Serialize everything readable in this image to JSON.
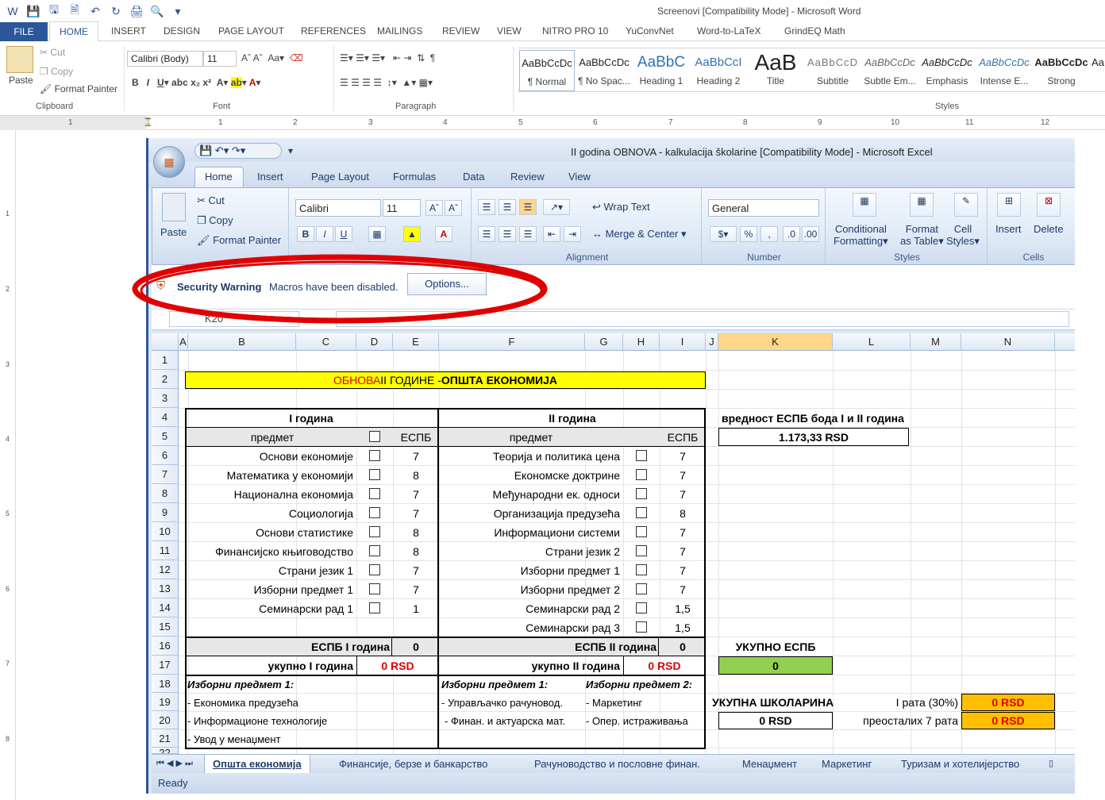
{
  "word": {
    "window_title": "Screenovi [Compatibility Mode] - Microsoft Word",
    "tabs": [
      "FILE",
      "HOME",
      "INSERT",
      "DESIGN",
      "PAGE LAYOUT",
      "REFERENCES",
      "MAILINGS",
      "REVIEW",
      "VIEW",
      "NITRO PRO 10",
      "YuConvNet",
      "Word-to-LaTeX",
      "GrindEQ Math"
    ],
    "clipboard": {
      "paste": "Paste",
      "cut": "Cut",
      "copy": "Copy",
      "format_painter": "Format Painter",
      "label": "Clipboard"
    },
    "font": {
      "name": "Calibri (Body)",
      "size": "11",
      "label": "Font"
    },
    "paragraph_label": "Paragraph",
    "styles_label": "Styles",
    "styles": [
      {
        "preview": "AaBbCcDc",
        "name": "¶ Normal"
      },
      {
        "preview": "AaBbCcDc",
        "name": "¶ No Spac..."
      },
      {
        "preview": "AaBbC",
        "name": "Heading 1"
      },
      {
        "preview": "AaBbCcI",
        "name": "Heading 2"
      },
      {
        "preview": "AaB",
        "name": "Title"
      },
      {
        "preview": "AaBbCcD",
        "name": "Subtitle"
      },
      {
        "preview": "AaBbCcDc",
        "name": "Subtle Em..."
      },
      {
        "preview": "AaBbCcDc",
        "name": "Emphasis"
      },
      {
        "preview": "AaBbCcDc",
        "name": "Intense E..."
      },
      {
        "preview": "AaBbCcDc",
        "name": "Strong"
      },
      {
        "preview": "Aa",
        "name": ""
      }
    ],
    "ruler_numbers": [
      "1",
      "1",
      "2",
      "3",
      "4",
      "5",
      "6",
      "7",
      "8",
      "9",
      "10",
      "11",
      "12"
    ],
    "vruler_numbers": [
      "1",
      "2",
      "3",
      "4",
      "5",
      "6",
      "7",
      "8"
    ]
  },
  "excel": {
    "window_title": "II godina OBNOVA - kalkulacija školarine  [Compatibility Mode] - Microsoft Excel",
    "tabs": [
      "Home",
      "Insert",
      "Page Layout",
      "Formulas",
      "Data",
      "Review",
      "View"
    ],
    "clipboard": {
      "paste": "Paste",
      "cut": "Cut",
      "copy": "Copy",
      "format_painter": "Format Painter",
      "label": "Clipboard"
    },
    "font": {
      "name": "Calibri",
      "size": "11",
      "label": "Font"
    },
    "alignment": {
      "wrap": "Wrap Text",
      "merge": "Merge & Center",
      "label": "Alignment"
    },
    "number": {
      "format": "General",
      "label": "Number"
    },
    "styles": {
      "cond": "Conditional",
      "cond2": "Formatting",
      "fmt": "Format",
      "fmt2": "as Table",
      "cell": "Cell",
      "cell2": "Styles",
      "label": "Styles"
    },
    "cells": {
      "insert": "Insert",
      "delete": "Delete",
      "label": "Cells"
    },
    "security": {
      "title": "Security Warning",
      "message": "Macros have been disabled.",
      "button": "Options..."
    },
    "name_box": "K20",
    "columns": [
      "A",
      "B",
      "C",
      "D",
      "E",
      "F",
      "G",
      "H",
      "I",
      "J",
      "K",
      "L",
      "M",
      "N"
    ],
    "rows": [
      "1",
      "2",
      "3",
      "4",
      "5",
      "6",
      "7",
      "8",
      "9",
      "10",
      "11",
      "12",
      "13",
      "14",
      "15",
      "16",
      "17",
      "18",
      "19",
      "20",
      "21",
      "22"
    ],
    "title_red": "ОБНОВА",
    "title_rest": " II ГОДИНЕ - ",
    "title_bold": "ОПШТА ЕКОНОМИЈА",
    "year1": "I година",
    "year2": "II година",
    "subject": "предмет",
    "espb": "ЕСПБ",
    "espb_value_label": "вредност ЕСПБ бода I и II година",
    "espb_value": "1.173,33 RSD",
    "y1_subjects": [
      {
        "name": "Основи економије",
        "espb": "7"
      },
      {
        "name": "Математика у економији",
        "espb": "8"
      },
      {
        "name": "Национална економија",
        "espb": "7"
      },
      {
        "name": "Социологија",
        "espb": "7"
      },
      {
        "name": "Основи статистике",
        "espb": "8"
      },
      {
        "name": "Финансијско књиговодство",
        "espb": "8"
      },
      {
        "name": "Страни језик 1",
        "espb": "7"
      },
      {
        "name": "Изборни предмет 1",
        "espb": "7"
      },
      {
        "name": "Семинарски рад 1",
        "espb": "1"
      }
    ],
    "y2_subjects": [
      {
        "name": "Теорија и политика цена",
        "espb": "7"
      },
      {
        "name": "Економске доктрине",
        "espb": "7"
      },
      {
        "name": "Међународни ек. односи",
        "espb": "7"
      },
      {
        "name": "Организација предузећа",
        "espb": "8"
      },
      {
        "name": "Информациони системи",
        "espb": "7"
      },
      {
        "name": "Страни језик 2",
        "espb": "7"
      },
      {
        "name": "Изборни предмет 1",
        "espb": "7"
      },
      {
        "name": "Изборни предмет 2",
        "espb": "7"
      },
      {
        "name": "Семинарски рад 2",
        "espb": "1,5"
      },
      {
        "name": "Семинарски рад 3",
        "espb": "1,5"
      }
    ],
    "espb_y1_label": "ЕСПБ I година",
    "espb_y1": "0",
    "espb_y2_label": "ЕСПБ II година",
    "espb_y2": "0",
    "total_y1_label": "укупно I година",
    "total_y1": "0 RSD",
    "total_y2_label": "укупно II година",
    "total_y2": "0 RSD",
    "total_espb_label": "УКУПНО ЕСПБ",
    "total_espb": "0",
    "elective1_head": "Изборни предмет 1:",
    "elective1_y1": [
      "- Економика предузећа",
      "- Информационе технологије",
      "- Увод у менаџмент"
    ],
    "elective1_y2_head": "Изборни предмет 1:",
    "elective1_y2": [
      "- Управљачко рачуновод.",
      "- Финан. и актуарска мат."
    ],
    "elective2_head": "Изборни предмет 2:",
    "elective2": [
      "- Маркетинг",
      "- Опер. истраживања"
    ],
    "tuition_label": "УКУПНА ШКОЛАРИНА",
    "tuition": "0 RSD",
    "rate1_label": "I рата (30%)",
    "rate1": "0 RSD",
    "rate_rest_label": "преосталих 7 рата",
    "rate_rest": "0 RSD",
    "sheets": [
      "Општа економија",
      "Финансије, берзе и банкарство",
      "Рачуноводство и пословне финан.",
      "Менаџмент",
      "Маркетинг",
      "Туризам и хотелијерство"
    ],
    "status": "Ready"
  },
  "colors": {
    "word_blue": "#2b579a",
    "annotation_red": "#e00000",
    "yellow": "#ffff00",
    "green": "#92d050",
    "orange": "#ffc000"
  }
}
